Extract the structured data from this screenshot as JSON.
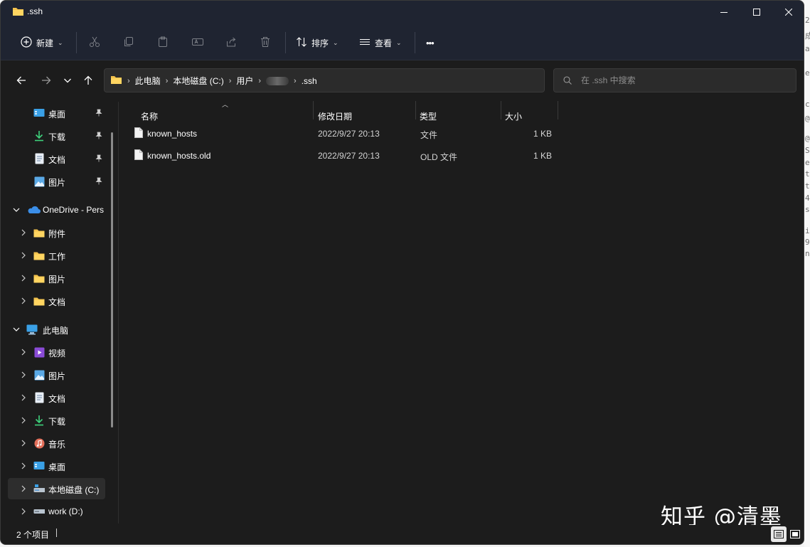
{
  "window": {
    "title": ".ssh"
  },
  "toolbar": {
    "new_label": "新建",
    "sort_label": "排序",
    "view_label": "查看",
    "more_label": "•••"
  },
  "address": {
    "crumbs": [
      "此电脑",
      "本地磁盘 (C:)",
      "用户",
      ".ssh"
    ]
  },
  "search": {
    "placeholder": "在 .ssh 中搜索"
  },
  "sidebar": {
    "quick_access": [
      {
        "label": "桌面",
        "icon": "desktop-icon",
        "pinned": true
      },
      {
        "label": "下载",
        "icon": "download-icon",
        "pinned": true
      },
      {
        "label": "文档",
        "icon": "document-icon",
        "pinned": true
      },
      {
        "label": "图片",
        "icon": "picture-icon",
        "pinned": true
      }
    ],
    "onedrive": {
      "label": "OneDrive - Pers",
      "children": [
        "附件",
        "工作",
        "图片",
        "文档"
      ]
    },
    "this_pc": {
      "label": "此电脑",
      "children": [
        {
          "label": "视频",
          "icon": "video-icon"
        },
        {
          "label": "图片",
          "icon": "picture-icon"
        },
        {
          "label": "文档",
          "icon": "document-icon"
        },
        {
          "label": "下载",
          "icon": "download-icon"
        },
        {
          "label": "音乐",
          "icon": "music-icon"
        },
        {
          "label": "桌面",
          "icon": "desktop-icon"
        },
        {
          "label": "本地磁盘 (C:)",
          "icon": "drive-c-icon"
        },
        {
          "label": "work (D:)",
          "icon": "drive-icon"
        }
      ]
    }
  },
  "columns": {
    "name": "名称",
    "modified": "修改日期",
    "type": "类型",
    "size": "大小"
  },
  "files": [
    {
      "name": "known_hosts",
      "modified": "2022/9/27 20:13",
      "type": "文件",
      "size": "1 KB"
    },
    {
      "name": "known_hosts.old",
      "modified": "2022/9/27 20:13",
      "type": "OLD 文件",
      "size": "1 KB"
    }
  ],
  "status": {
    "item_count": "2 个项目"
  },
  "watermark": "知乎 @清墨",
  "colors": {
    "background": "#1c1c1c",
    "titlebar": "#1f2431",
    "folder": "#f3c24d",
    "onedrive": "#3b8ee8"
  }
}
